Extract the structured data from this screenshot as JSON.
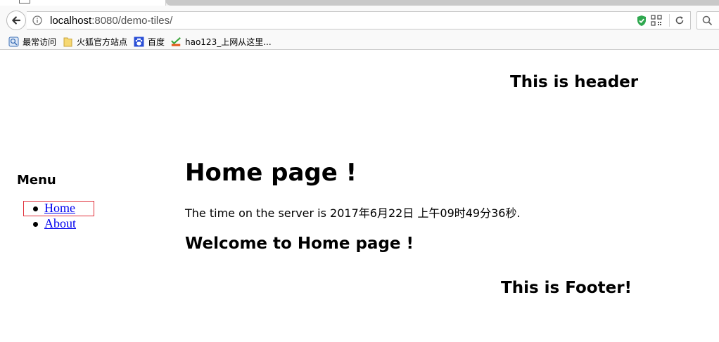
{
  "browser": {
    "url_host": "localhost",
    "url_path": ":8080/demo-tiles/",
    "accent_color": "#2fa84f"
  },
  "bookmarks": [
    {
      "label": "最常访问",
      "icon": "most-visited-icon"
    },
    {
      "label": "火狐官方站点",
      "icon": "folder-icon"
    },
    {
      "label": "百度",
      "icon": "baidu-paw-icon"
    },
    {
      "label": "hao123_上网从这里...",
      "icon": "hao123-icon"
    }
  ],
  "page": {
    "header": "This is header",
    "menu": {
      "title": "Menu",
      "items": [
        {
          "label": "Home"
        },
        {
          "label": "About"
        }
      ]
    },
    "body": {
      "title": "Home page !",
      "time_text": "The time on the server is 2017年6月22日 上午09时49分36秒.",
      "welcome": "Welcome to Home page !"
    },
    "footer": "This is Footer!"
  }
}
